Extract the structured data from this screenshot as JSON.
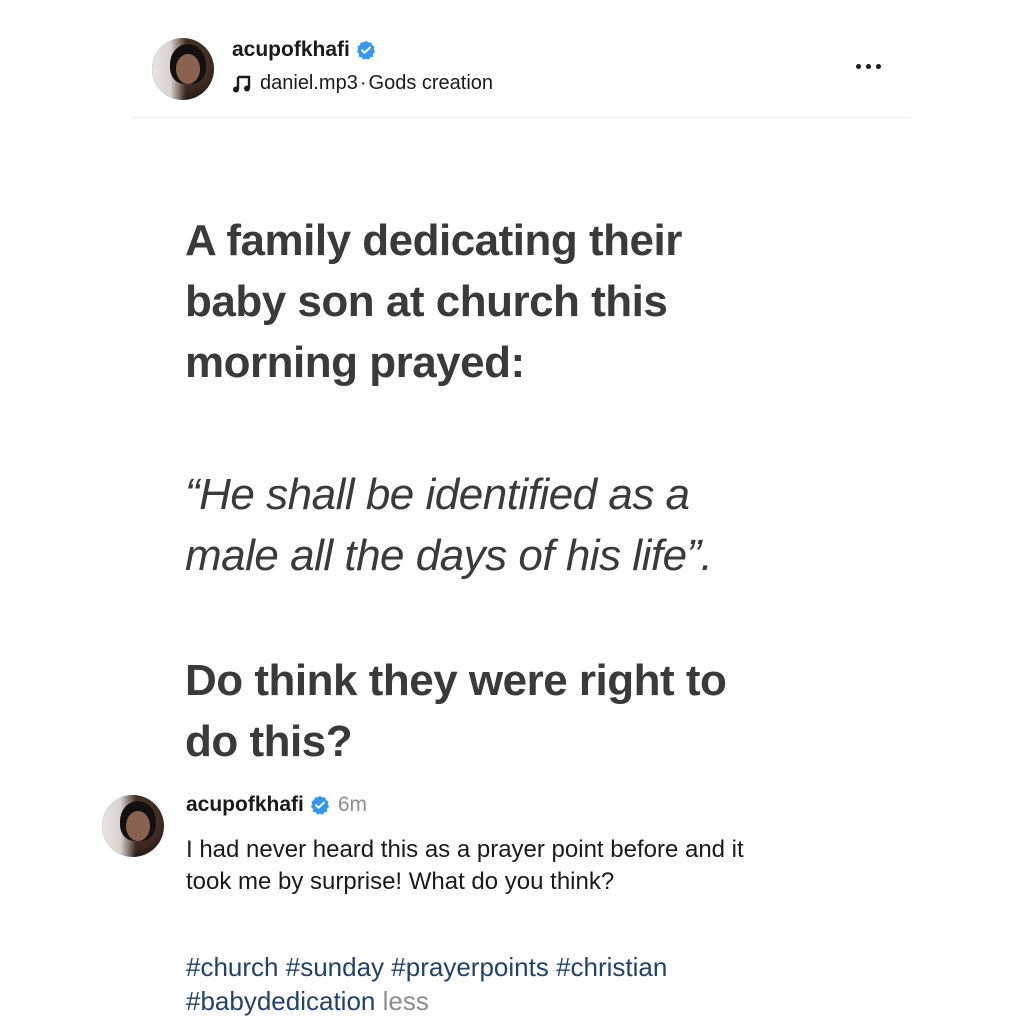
{
  "post": {
    "username": "acupofkhafi",
    "verified": true,
    "audio": {
      "track": "daniel.mp3",
      "separator": " · ",
      "album": "Gods creation"
    },
    "more_label": "More options"
  },
  "media_text": {
    "line_block1": [
      "A family dedicating their",
      "baby son at church this",
      "morning prayed:"
    ],
    "line_block2": [
      "“He shall be identified as a",
      "male all the days of his life”."
    ],
    "line_block3": [
      "Do think they were right to",
      "do this?"
    ]
  },
  "caption": {
    "username": "acupofkhafi",
    "time": "6m",
    "text_lines": [
      "I had never heard this as a prayer point before and it",
      "took me by surprise! What do you think?"
    ],
    "hashtags_line1": [
      "#church",
      "#sunday",
      "#prayerpoints",
      "#christian"
    ],
    "hashtags_line2": [
      "#babydedication"
    ],
    "less_label": "less"
  },
  "colors": {
    "verified": "#3797f0",
    "hashtag": "#23426b",
    "muted": "#8e8e8e"
  },
  "icons": {
    "verified": "verified-badge-icon",
    "music": "music-note-icon",
    "more": "ellipsis-icon"
  }
}
